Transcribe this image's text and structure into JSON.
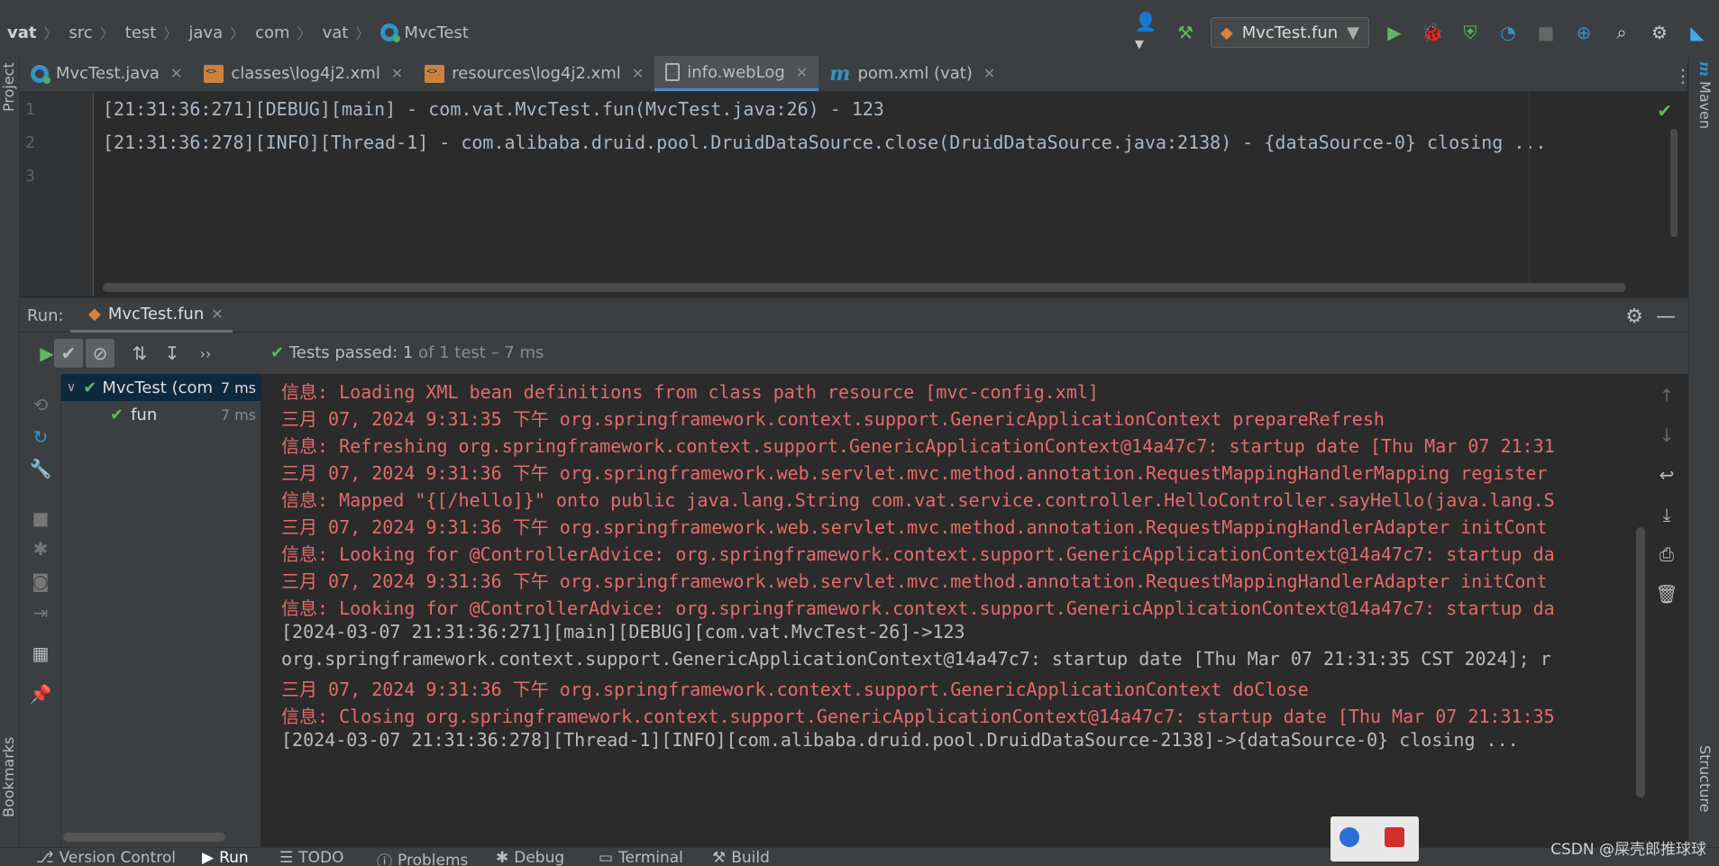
{
  "breadcrumb": {
    "items": [
      "vat",
      "src",
      "test",
      "java",
      "com",
      "vat",
      "MvcTest"
    ]
  },
  "toolbar": {
    "run_config": "MvcTest.fun"
  },
  "tabs": [
    {
      "label": "MvcTest.java",
      "icon": "java-class-icon"
    },
    {
      "label": "classes\\log4j2.xml",
      "icon": "xml-file-icon"
    },
    {
      "label": "resources\\log4j2.xml",
      "icon": "xml-file-icon"
    },
    {
      "label": "info.webLog",
      "icon": "log-file-icon"
    },
    {
      "label": "pom.xml (vat)",
      "icon": "maven-icon"
    }
  ],
  "left_strip": {
    "project": "Project",
    "bookmarks": "Bookmarks"
  },
  "right_strip": {
    "maven": "Maven",
    "structure": "Structure"
  },
  "editor": {
    "lines": [
      {
        "no": "1",
        "text": "[21:31:36:271][DEBUG][main] - com.vat.MvcTest.fun(MvcTest.java:26) - 123"
      },
      {
        "no": "2",
        "text": "[21:31:36:278][INFO][Thread-1] - com.alibaba.druid.pool.DruidDataSource.close(DruidDataSource.java:2138) - {dataSource-0} closing ..."
      },
      {
        "no": "3",
        "text": ""
      }
    ]
  },
  "run": {
    "label": "Run:",
    "tab": "MvcTest.fun",
    "tests_passed": "Tests passed: 1",
    "tests_detail": " of 1 test – 7 ms"
  },
  "tree": [
    {
      "name": "MvcTest (com",
      "time": "7 ms"
    },
    {
      "name": "fun",
      "time": "7 ms"
    }
  ],
  "console": [
    {
      "style": "red",
      "text": "信息: Loading XML bean definitions from class path resource [mvc-config.xml]"
    },
    {
      "style": "red",
      "text": "三月 07, 2024 9:31:35 下午 org.springframework.context.support.GenericApplicationContext prepareRefresh"
    },
    {
      "style": "red",
      "text": "信息: Refreshing org.springframework.context.support.GenericApplicationContext@14a47c7: startup date [Thu Mar 07 21:31"
    },
    {
      "style": "red",
      "text": "三月 07, 2024 9:31:36 下午 org.springframework.web.servlet.mvc.method.annotation.RequestMappingHandlerMapping register"
    },
    {
      "style": "red",
      "text": "信息: Mapped \"{[/hello]}\" onto public java.lang.String com.vat.service.controller.HelloController.sayHello(java.lang.S"
    },
    {
      "style": "red",
      "text": "三月 07, 2024 9:31:36 下午 org.springframework.web.servlet.mvc.method.annotation.RequestMappingHandlerAdapter initCont"
    },
    {
      "style": "red",
      "text": "信息: Looking for @ControllerAdvice: org.springframework.context.support.GenericApplicationContext@14a47c7: startup da"
    },
    {
      "style": "red",
      "text": "三月 07, 2024 9:31:36 下午 org.springframework.web.servlet.mvc.method.annotation.RequestMappingHandlerAdapter initCont"
    },
    {
      "style": "red",
      "text": "信息: Looking for @ControllerAdvice: org.springframework.context.support.GenericApplicationContext@14a47c7: startup da"
    },
    {
      "style": "gray",
      "text": "[2024-03-07 21:31:36:271][main][DEBUG][com.vat.MvcTest-26]->123"
    },
    {
      "style": "gray",
      "text": "org.springframework.context.support.GenericApplicationContext@14a47c7: startup date [Thu Mar 07 21:31:35 CST 2024]; r"
    },
    {
      "style": "red",
      "text": "三月 07, 2024 9:31:36 下午 org.springframework.context.support.GenericApplicationContext doClose"
    },
    {
      "style": "red",
      "text": "信息: Closing org.springframework.context.support.GenericApplicationContext@14a47c7: startup date [Thu Mar 07 21:31:35"
    },
    {
      "style": "gray",
      "text": "[2024-03-07 21:31:36:278][Thread-1][INFO][com.alibaba.druid.pool.DruidDataSource-2138]->{dataSource-0} closing ..."
    }
  ],
  "bottom": {
    "version_control": "Version Control",
    "run": "Run",
    "todo": "TODO",
    "problems": "Problems",
    "debug": "Debug",
    "terminal": "Terminal",
    "build": "Build"
  },
  "watermark": "CSDN @屎壳郎推球球",
  "colors": {
    "accent": "#4a88c7",
    "success": "#5fb760",
    "console_error": "#e56b6b"
  }
}
